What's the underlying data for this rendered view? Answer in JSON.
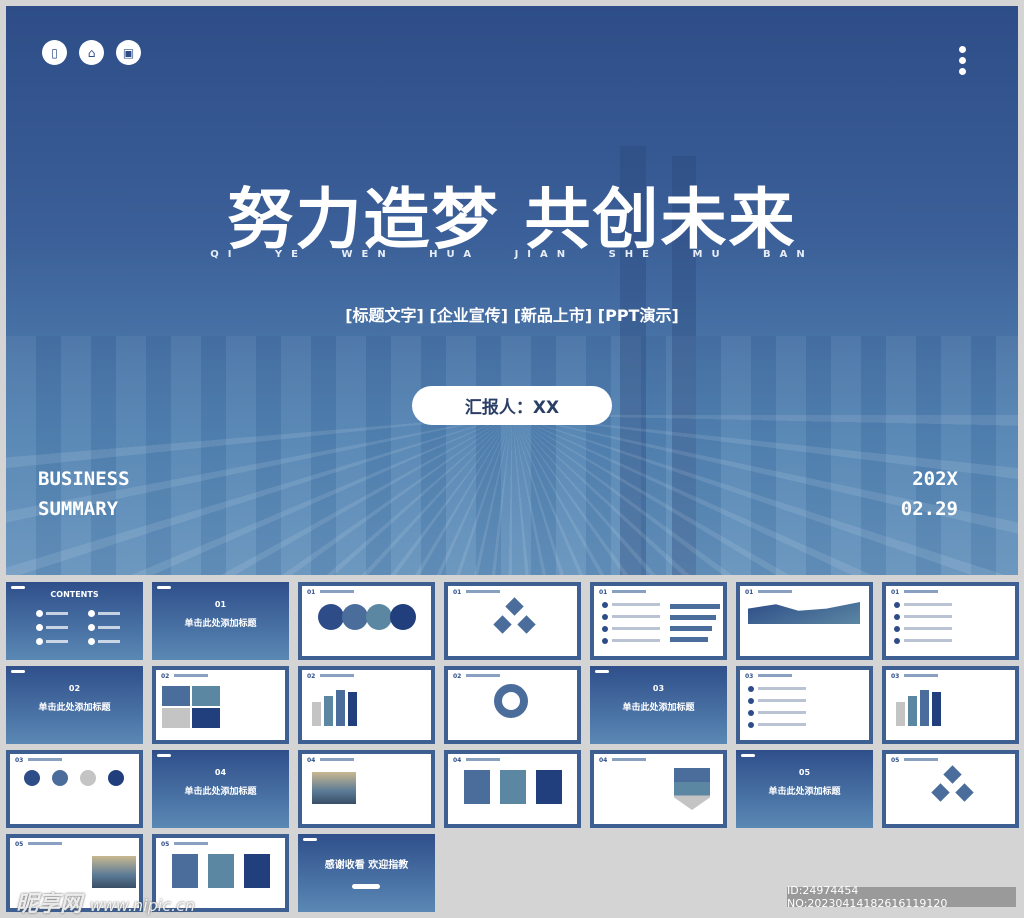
{
  "cover": {
    "title": "努力造梦 共创未来",
    "pinyin": "QI YE WEN HUA JIAN SHE MU BAN",
    "tags": "[标题文字] [企业宣传] [新品上市] [PPT演示]",
    "reporter": "汇报人：XX",
    "business": "BUSINESS",
    "summary": "SUMMARY",
    "year": "202X",
    "date": "02.29",
    "icons": [
      "book-icon",
      "home-icon",
      "image-icon"
    ]
  },
  "colors": {
    "primary": "#2e4d88",
    "mid": "#4b6d9c",
    "teal": "#5b87a3",
    "gray": "#c4c4c4",
    "navy": "#213f7c"
  },
  "thumbnails": [
    {
      "kind": "contents",
      "text": "CONTENTS"
    },
    {
      "kind": "section",
      "num": "01",
      "text": "单击此处添加标题"
    },
    {
      "kind": "circles",
      "num": "01"
    },
    {
      "kind": "diamonds",
      "num": "01"
    },
    {
      "kind": "hbars",
      "num": "01"
    },
    {
      "kind": "area",
      "num": "01"
    },
    {
      "kind": "list",
      "num": "01"
    },
    {
      "kind": "section",
      "num": "02",
      "text": "单击此处添加标题"
    },
    {
      "kind": "grid",
      "num": "02"
    },
    {
      "kind": "bars",
      "num": "02"
    },
    {
      "kind": "donut",
      "num": "02"
    },
    {
      "kind": "section",
      "num": "03",
      "text": "单击此处添加标题"
    },
    {
      "kind": "list",
      "num": "03"
    },
    {
      "kind": "bars",
      "num": "03"
    },
    {
      "kind": "icons",
      "num": "03"
    },
    {
      "kind": "section",
      "num": "04",
      "text": "单击此处添加标题"
    },
    {
      "kind": "photo",
      "num": "04"
    },
    {
      "kind": "cards",
      "num": "04"
    },
    {
      "kind": "arrow",
      "num": "04"
    },
    {
      "kind": "section",
      "num": "05",
      "text": "单击此处添加标题"
    },
    {
      "kind": "diamonds",
      "num": "05"
    },
    {
      "kind": "photo",
      "num": "05"
    },
    {
      "kind": "cards",
      "num": "05"
    },
    {
      "kind": "thanks",
      "text": "感谢收看 欢迎指教"
    }
  ],
  "watermark": {
    "logo": "昵享网",
    "url": "www.nipic.cn"
  },
  "image_id": "ID:24974454 NO:20230414182616119120"
}
